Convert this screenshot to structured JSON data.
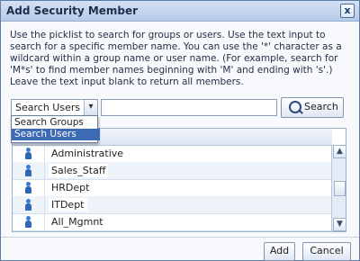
{
  "dialog": {
    "title": "Add Security Member",
    "close_label": "x",
    "description": "Use the picklist to search for groups or users. Use the text input to search for a specific member name. You can use the '*' character as a wildcard within a group name or user name. (For example, search for 'M*s' to find member names beginning with 'M' and ending with 's'.) Leave the text input blank to return all members."
  },
  "search": {
    "type_selected": "Search Users",
    "type_options": [
      "Search Groups",
      "Search Users"
    ],
    "input_value": "",
    "button_label": "Search"
  },
  "table": {
    "header_partial": "ember",
    "rows": [
      {
        "name": "Administrative"
      },
      {
        "name": "Sales_Staff"
      },
      {
        "name": "HRDept"
      },
      {
        "name": "ITDept"
      },
      {
        "name": "All_Mgmnt"
      }
    ]
  },
  "footer": {
    "add_label": "Add",
    "cancel_label": "Cancel"
  },
  "icons": [
    "close-icon",
    "search-icon",
    "user-icon",
    "dropdown-arrow-icon",
    "scroll-up-icon",
    "scroll-down-icon"
  ],
  "colors": {
    "titlebar": "#c7d7ee",
    "accent": "#3c6ab5",
    "user_icon": "#2f67b8"
  }
}
